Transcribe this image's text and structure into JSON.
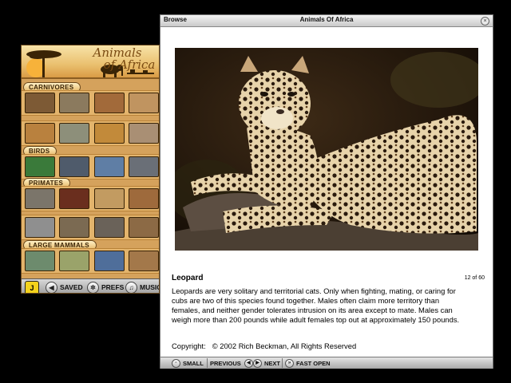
{
  "app": {
    "banner_title_line1": "Animals",
    "banner_title_line2": "of Africa",
    "sections": [
      {
        "label": "CARNIVORES",
        "rows": [
          [
            "#7d5a35",
            "#8b7a5e",
            "#a26a3a",
            "#c09460"
          ],
          [
            "#b9813e",
            "#8d8f7a",
            "#c28a3a",
            "#a98f74"
          ]
        ]
      },
      {
        "label": "BIRDS",
        "rows": [
          [
            "#3a7a3a",
            "#4f5b6b",
            "#5f7ea5",
            "#6a6f77"
          ]
        ]
      },
      {
        "label": "PRIMATES",
        "rows": [
          [
            "#7b756a",
            "#6a2e1e",
            "#c29b61",
            "#9e6a3c"
          ],
          [
            "#8f8f8f",
            "#7b6a52",
            "#6a6259",
            "#8c6a45"
          ]
        ]
      },
      {
        "label": "LARGE MAMMALS",
        "rows": [
          [
            "#6d8b6d",
            "#9aa36a",
            "#4f6e9a",
            "#a3784a"
          ]
        ]
      }
    ],
    "toolbar": {
      "logo": "J",
      "saved": "SAVED",
      "prefs": "PREFS",
      "music": "MUSIC"
    }
  },
  "browse": {
    "label": "Browse",
    "title": "Animals Of Africa",
    "animal_name": "Leopard",
    "counter": "12 of 60",
    "description": "Leopards are very solitary and territorial cats. Only when fighting, mating, or caring for cubs are two of this species found together. Males often claim more territory than females, and neither gender tolerates intrusion on its area except to mate. Males can weigh more than 200 pounds while adult females top out at approximately 150 pounds.",
    "copyright_label": "Copyright:",
    "copyright_text": "© 2002 Rich Beckman, All Rights Reserved",
    "toolbar": {
      "small": "SMALL",
      "previous": "PREVIOUS",
      "next": "NEXT",
      "fast_open": "FAST OPEN"
    }
  },
  "colors": {
    "app_bg": "#d5a25c",
    "banner_text": "#7a4a12",
    "browse_bg": "#ffffff"
  }
}
